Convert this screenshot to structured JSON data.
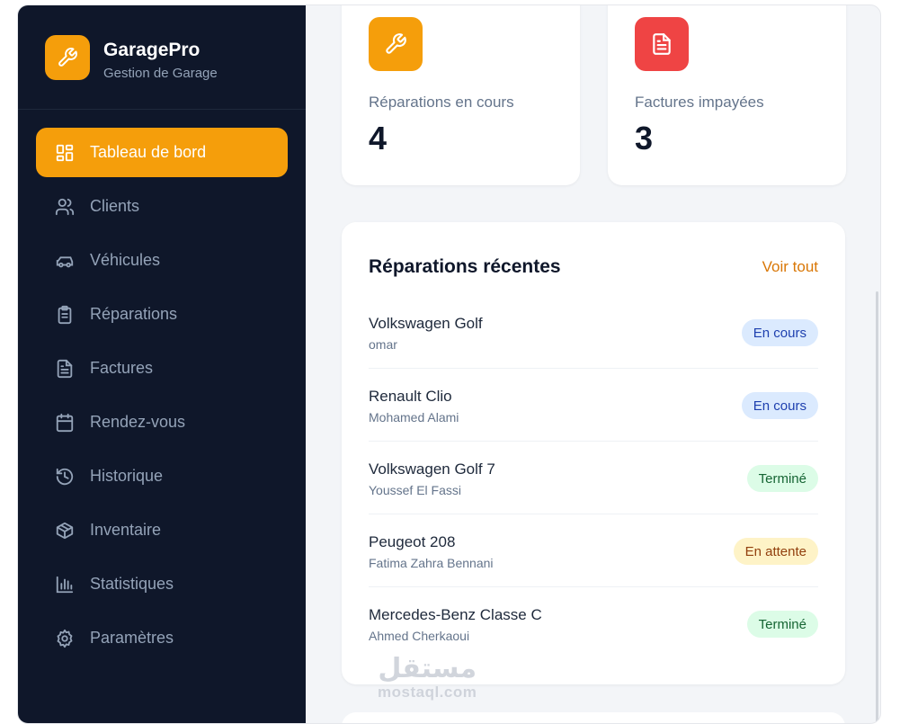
{
  "brand": {
    "name": "GaragePro",
    "subtitle": "Gestion de Garage",
    "logo_icon": "wrench-icon"
  },
  "nav": [
    {
      "label": "Tableau de bord",
      "icon": "dashboard-icon",
      "active": true
    },
    {
      "label": "Clients",
      "icon": "users-icon"
    },
    {
      "label": "Véhicules",
      "icon": "car-icon"
    },
    {
      "label": "Réparations",
      "icon": "clipboard-icon"
    },
    {
      "label": "Factures",
      "icon": "file-icon"
    },
    {
      "label": "Rendez-vous",
      "icon": "calendar-icon"
    },
    {
      "label": "Historique",
      "icon": "history-icon"
    },
    {
      "label": "Inventaire",
      "icon": "box-icon"
    },
    {
      "label": "Statistiques",
      "icon": "bar-chart-icon"
    },
    {
      "label": "Paramètres",
      "icon": "gear-icon"
    }
  ],
  "stats": [
    {
      "label": "Réparations en cours",
      "value": "4",
      "icon": "wrench-icon",
      "color": "#f59e0b"
    },
    {
      "label": "Factures impayées",
      "value": "3",
      "icon": "file-icon",
      "color": "#ef4444"
    }
  ],
  "recent": {
    "title": "Réparations récentes",
    "link": "Voir tout",
    "rows": [
      {
        "vehicle": "Volkswagen Golf",
        "client": "omar",
        "status": "En cours",
        "tone": "blue"
      },
      {
        "vehicle": "Renault Clio",
        "client": "Mohamed Alami",
        "status": "En cours",
        "tone": "blue"
      },
      {
        "vehicle": "Volkswagen Golf 7",
        "client": "Youssef El Fassi",
        "status": "Terminé",
        "tone": "green"
      },
      {
        "vehicle": "Peugeot 208",
        "client": "Fatima Zahra Bennani",
        "status": "En attente",
        "tone": "yellow"
      },
      {
        "vehicle": "Mercedes-Benz Classe C",
        "client": "Ahmed Cherkaoui",
        "status": "Terminé",
        "tone": "green"
      }
    ]
  },
  "watermark": {
    "arabic": "مستقل",
    "latin": "mostaql.com"
  },
  "colors": {
    "sidebar": "#0f172a",
    "accent": "#f59e0b",
    "danger": "#ef4444"
  }
}
